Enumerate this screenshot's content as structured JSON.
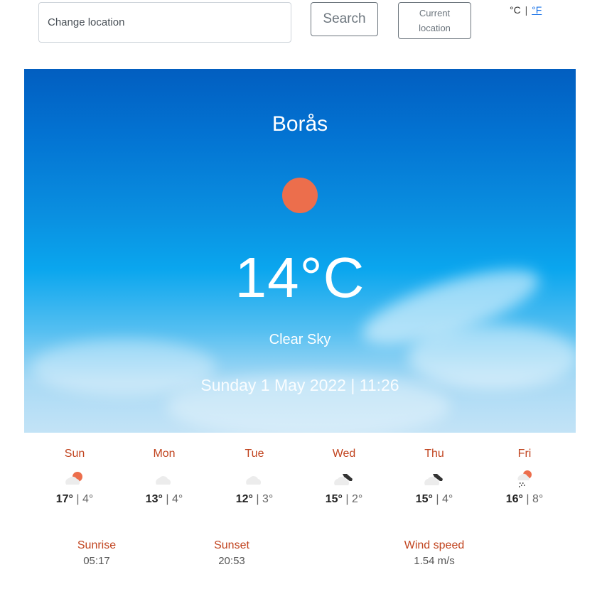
{
  "search": {
    "placeholder": "Change location",
    "search_label": "Search",
    "current_location_line1": "Current",
    "current_location_line2": "location"
  },
  "units": {
    "celsius": "°C",
    "separator": "|",
    "fahrenheit": "°F",
    "active": "celsius"
  },
  "current": {
    "city": "Borås",
    "icon": "sun-icon",
    "temperature": "14°C",
    "description": "Clear Sky",
    "datetime": "Sunday 1 May 2022 | 11:26"
  },
  "forecast": [
    {
      "day": "Sun",
      "icon": "partly-cloudy-sun-icon",
      "high": "17°",
      "low": "4°"
    },
    {
      "day": "Mon",
      "icon": "cloud-icon",
      "high": "13°",
      "low": "4°"
    },
    {
      "day": "Tue",
      "icon": "cloud-icon",
      "high": "12°",
      "low": "3°"
    },
    {
      "day": "Wed",
      "icon": "broken-clouds-icon",
      "high": "15°",
      "low": "2°"
    },
    {
      "day": "Thu",
      "icon": "broken-clouds-icon",
      "high": "15°",
      "low": "4°"
    },
    {
      "day": "Fri",
      "icon": "rain-sun-icon",
      "high": "16°",
      "low": "8°"
    }
  ],
  "details": {
    "sunrise_label": "Sunrise",
    "sunrise": "05:17",
    "sunset_label": "Sunset",
    "sunset": "20:53",
    "wind_label": "Wind speed",
    "wind": "1.54 m/s"
  },
  "colors": {
    "accent": "#c1441f",
    "sun": "#ec6e4c",
    "link": "#1a73e8"
  }
}
